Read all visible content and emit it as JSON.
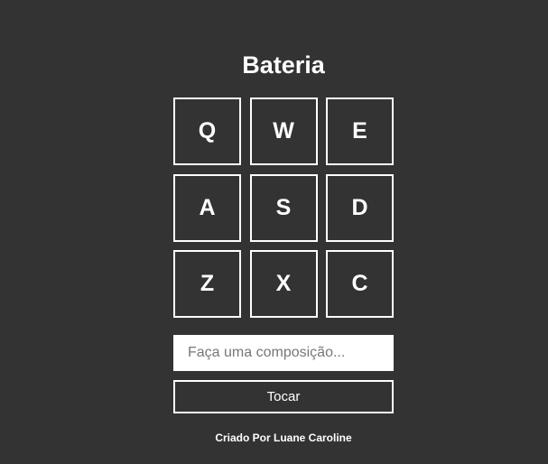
{
  "app": {
    "title": "Bateria"
  },
  "keys": [
    "Q",
    "W",
    "E",
    "A",
    "S",
    "D",
    "Z",
    "X",
    "C"
  ],
  "composer": {
    "value": "",
    "placeholder": "Faça uma composição..."
  },
  "play_button": {
    "label": "Tocar"
  },
  "footer": {
    "credit": "Criado Por Luane Caroline"
  },
  "colors": {
    "background": "#333333",
    "foreground": "#ffffff"
  }
}
